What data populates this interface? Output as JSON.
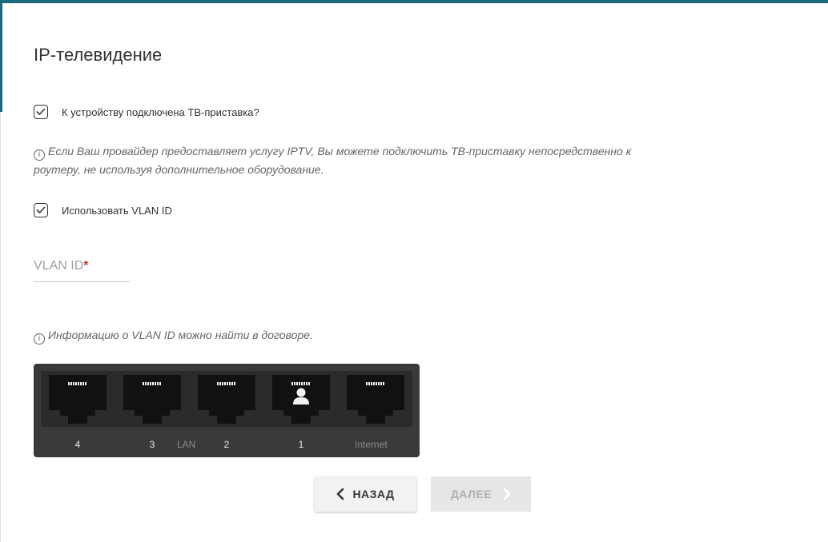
{
  "page": {
    "title": "IP-телевидение"
  },
  "settings": {
    "stb_connected": {
      "label": "К устройству подключена ТВ-приставка?",
      "checked": true
    },
    "info_iptv": "Если Ваш провайдер предоставляет услугу IPTV, Вы можете подключить ТВ-приставку непосредственно к",
    "info_iptv_line2": "роутеру, не используя дополнительное оборудование.",
    "use_vlan": {
      "label": "Использовать VLAN ID",
      "checked": true
    },
    "vlan_field": {
      "label": "VLAN ID",
      "required_mark": "*",
      "value": ""
    },
    "info_vlan": "Информацию о VLAN ID можно найти в договоре."
  },
  "ports": {
    "items": [
      {
        "number": "4",
        "selected": false
      },
      {
        "number": "3",
        "selected": false
      },
      {
        "number": "2",
        "selected": false
      },
      {
        "number": "1",
        "selected": true
      },
      {
        "number": "",
        "selected": false
      }
    ],
    "lan_caption": "LAN",
    "internet_caption": "Internet"
  },
  "buttons": {
    "back": "НАЗАД",
    "next": "ДАЛЕЕ",
    "next_disabled": true
  },
  "colors": {
    "accent": "#1a6a7f",
    "required": "#c0392b",
    "panel": "#3a3a3a"
  },
  "icons": {
    "info": "info-circle-icon",
    "check": "checkmark-icon",
    "back": "chevron-left-icon",
    "next": "chevron-right-icon",
    "port": "ethernet-port-icon",
    "user": "user-icon"
  }
}
